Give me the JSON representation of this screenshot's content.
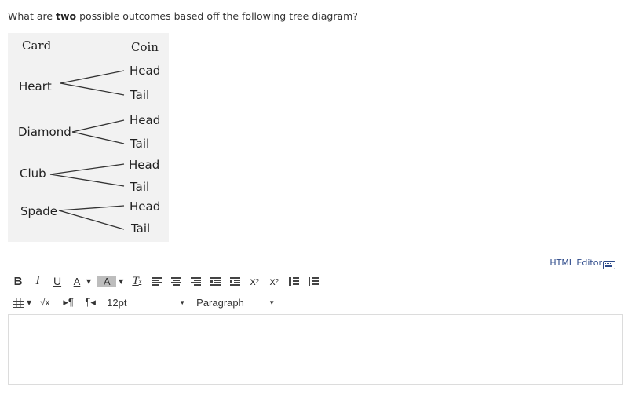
{
  "question": {
    "prefix": "What are ",
    "emphasis": "two",
    "suffix": " possible outcomes based off the following tree diagram?"
  },
  "tree_diagram": {
    "column_headers": {
      "left": "Card",
      "right": "Coin"
    },
    "branches": [
      {
        "card": "Heart",
        "outcomes": [
          "Head",
          "Tail"
        ]
      },
      {
        "card": "Diamond",
        "outcomes": [
          "Head",
          "Tail"
        ]
      },
      {
        "card": "Club",
        "outcomes": [
          "Head",
          "Tail"
        ]
      },
      {
        "card": "Spade",
        "outcomes": [
          "Head",
          "Tail"
        ]
      }
    ]
  },
  "editor": {
    "html_editor_link": "HTML Editor",
    "toolbar": {
      "bold": "B",
      "italic": "I",
      "underline": "U",
      "font_color": "A",
      "background_color": "A",
      "clear_formatting": "T",
      "superscript": "x",
      "subscript": "x",
      "sqrt": "√x",
      "font_size": "12pt",
      "paragraph_format": "Paragraph"
    },
    "content": ""
  }
}
